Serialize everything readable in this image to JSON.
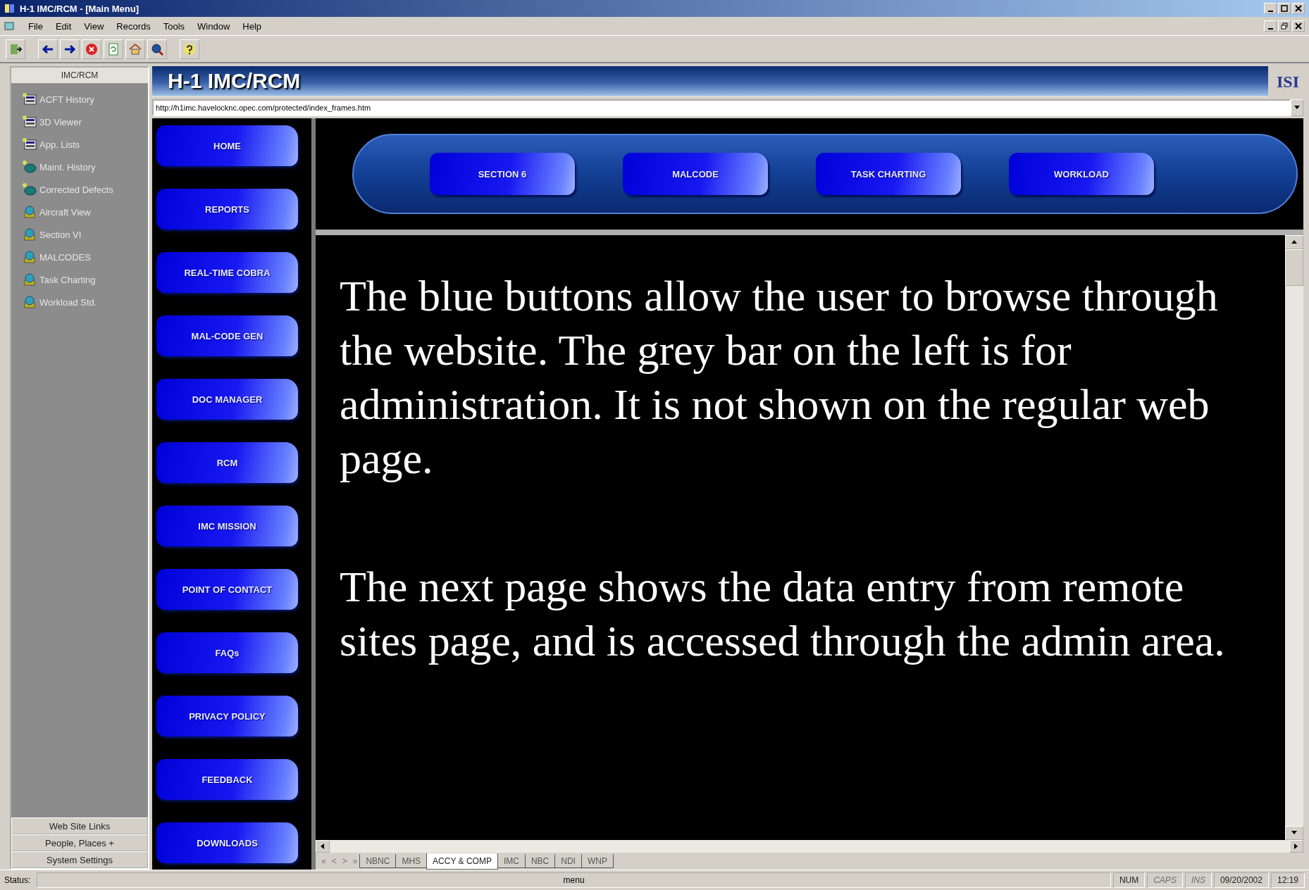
{
  "window": {
    "title": "H-1 IMC/RCM - [Main Menu]"
  },
  "menu": [
    "File",
    "Edit",
    "View",
    "Records",
    "Tools",
    "Window",
    "Help"
  ],
  "sidebar": {
    "title": "IMC/RCM",
    "items": [
      {
        "label": "ACFT History",
        "kind": "form"
      },
      {
        "label": "3D Viewer",
        "kind": "form"
      },
      {
        "label": "App. Lists",
        "kind": "form"
      },
      {
        "label": "Maint. History",
        "kind": "record"
      },
      {
        "label": "Corrected Defects",
        "kind": "record"
      },
      {
        "label": "Aircraft View",
        "kind": "globe"
      },
      {
        "label": "Section VI",
        "kind": "globe"
      },
      {
        "label": "MALCODES",
        "kind": "globe"
      },
      {
        "label": "Task Charting",
        "kind": "globe"
      },
      {
        "label": "Workload Std.",
        "kind": "globe"
      }
    ],
    "footer_buttons": [
      "Web Site Links",
      "People, Places +",
      "System Settings"
    ]
  },
  "header": {
    "title": "H-1 IMC/RCM",
    "logo": "ISI"
  },
  "address": {
    "value": "http://h1imc.havelocknc.opec.com/protected/index_frames.htm"
  },
  "nav_buttons": [
    "HOME",
    "REPORTS",
    "REAL-TIME COBRA",
    "MAL-CODE GEN",
    "DOC MANAGER",
    "RCM",
    "IMC MISSION",
    "POINT OF CONTACT",
    "FAQs",
    "PRIVACY POLICY",
    "FEEDBACK",
    "DOWNLOADS"
  ],
  "section_buttons": [
    "SECTION 6",
    "MALCODE",
    "TASK CHARTING",
    "WORKLOAD"
  ],
  "paragraphs": [
    "The blue buttons allow the user to browse through the website. The grey bar on the left is for administration. It is not shown on the regular web page.",
    "The next page shows the data entry from remote sites page, and is accessed through the admin area."
  ],
  "tab_nav": [
    "«",
    "<",
    ">",
    "»"
  ],
  "sheet_tabs": [
    {
      "label": "NBNC",
      "selected": false
    },
    {
      "label": "MHS",
      "selected": false
    },
    {
      "label": "ACCY & COMP",
      "selected": true
    },
    {
      "label": "IMC",
      "selected": false
    },
    {
      "label": "NBC",
      "selected": false
    },
    {
      "label": "NDI",
      "selected": false
    },
    {
      "label": "WNP",
      "selected": false
    }
  ],
  "status_bar": {
    "label": "Status:",
    "message": "menu",
    "indicators": [
      {
        "label": "NUM",
        "disabled": false
      },
      {
        "label": "CAPS",
        "disabled": true
      },
      {
        "label": "INS",
        "disabled": true
      }
    ],
    "date": "09/20/2002",
    "time": "12:19"
  }
}
